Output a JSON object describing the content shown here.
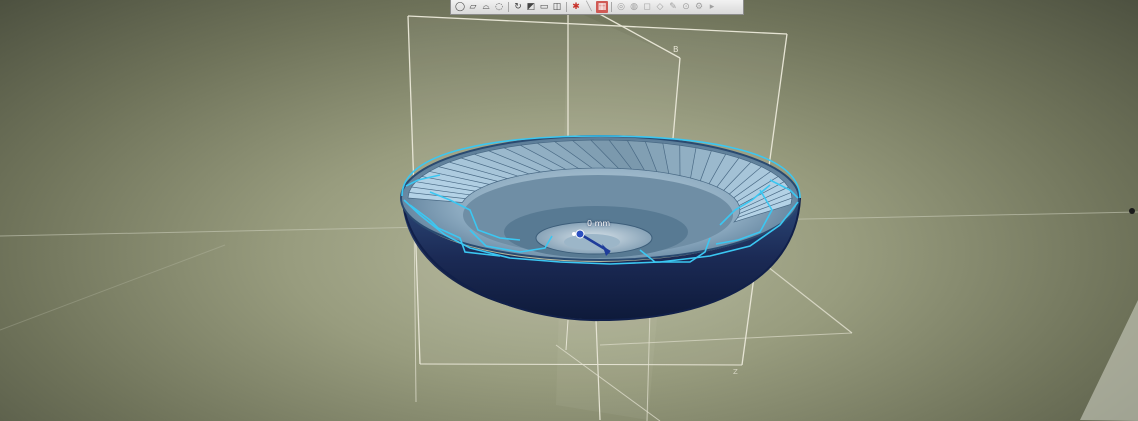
{
  "toolbar": {
    "buttons": [
      {
        "name": "sphere-icon",
        "glyph": "◯",
        "state": "normal"
      },
      {
        "name": "cube-icon",
        "glyph": "▱",
        "state": "normal"
      },
      {
        "name": "cylinder-icon",
        "glyph": "⌓",
        "state": "normal"
      },
      {
        "name": "torus-icon",
        "glyph": "◌",
        "state": "normal"
      },
      {
        "name": "rotate-icon",
        "glyph": "↻",
        "state": "normal"
      },
      {
        "name": "section-view-icon",
        "glyph": "◩",
        "state": "normal"
      },
      {
        "name": "document-icon",
        "glyph": "▭",
        "state": "normal"
      },
      {
        "name": "split-view-icon",
        "glyph": "◫",
        "state": "normal"
      },
      {
        "name": "highlight-icon",
        "glyph": "✱",
        "state": "red"
      },
      {
        "name": "measure-icon",
        "glyph": "╲",
        "state": "dim"
      },
      {
        "name": "active-tool-icon",
        "glyph": "▦",
        "state": "active"
      },
      {
        "name": "render-mode-icon",
        "glyph": "◎",
        "state": "dim"
      },
      {
        "name": "lighting-icon",
        "glyph": "◍",
        "state": "dim"
      },
      {
        "name": "hidden-line-icon",
        "glyph": "◻",
        "state": "dim"
      },
      {
        "name": "wireframe-icon",
        "glyph": "◇",
        "state": "dim"
      },
      {
        "name": "edit-icon",
        "glyph": "✎",
        "state": "dim"
      },
      {
        "name": "zoom-icon",
        "glyph": "⊙",
        "state": "dim"
      },
      {
        "name": "settings-icon",
        "glyph": "⚙",
        "state": "dim"
      },
      {
        "name": "more-icon",
        "glyph": "▸",
        "state": "dim"
      }
    ]
  },
  "scene": {
    "dimension_label": "0 mm",
    "plane_label": "B",
    "origin_marker": "Z"
  },
  "colors": {
    "background_center": "#b4b89c",
    "background_edge": "#4d5140",
    "bowl_outer": "#1b2a55",
    "bowl_inner": "#7ea0b4",
    "blade": "#9fb8c6",
    "highlight_edge": "#3bc7f2",
    "plane_frame": "#e6e4d4"
  }
}
